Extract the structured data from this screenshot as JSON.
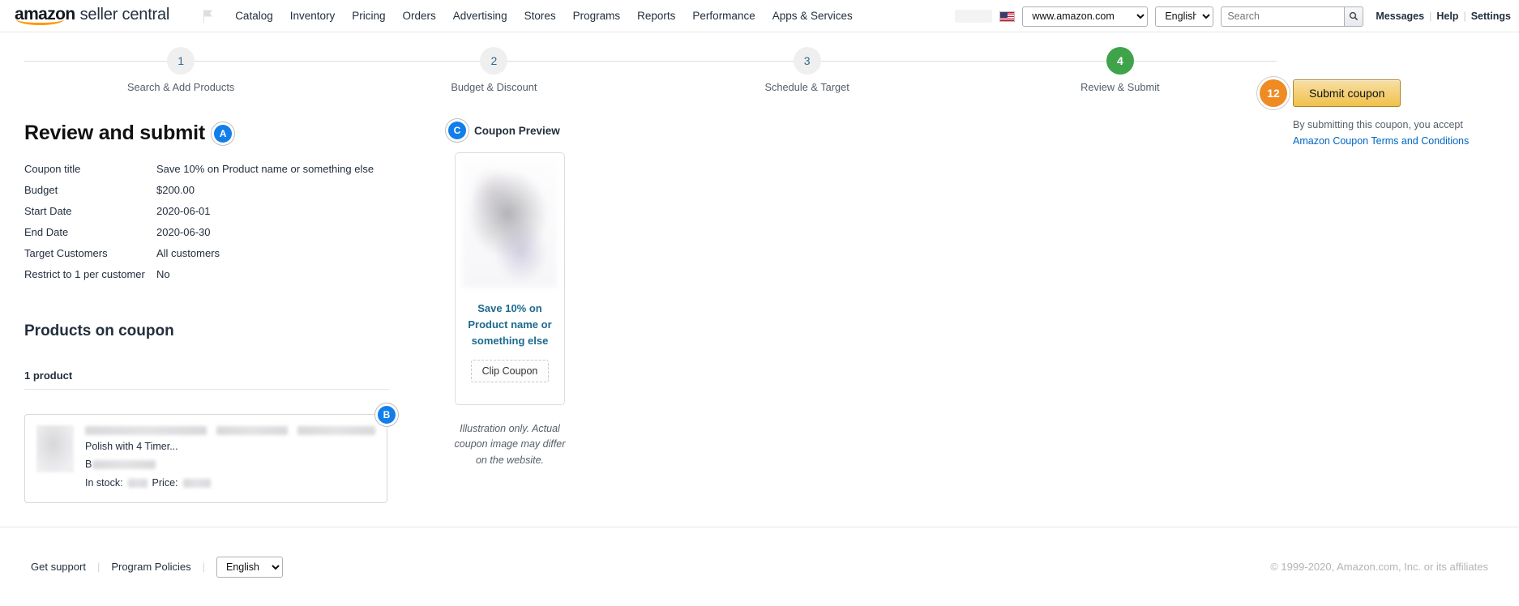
{
  "topnav": {
    "brand_main": "amazon",
    "brand_sub": "seller central",
    "flag_icon": "flag-icon",
    "links": [
      {
        "label": "Catalog"
      },
      {
        "label": "Inventory"
      },
      {
        "label": "Pricing"
      },
      {
        "label": "Orders"
      },
      {
        "label": "Advertising"
      },
      {
        "label": "Stores"
      },
      {
        "label": "Programs"
      },
      {
        "label": "Reports"
      },
      {
        "label": "Performance"
      },
      {
        "label": "Apps & Services"
      }
    ],
    "marketplace": "www.amazon.com",
    "marketplace_options": [
      "www.amazon.com"
    ],
    "language": "English",
    "language_options": [
      "English"
    ],
    "search_placeholder": "Search",
    "search_value": "",
    "search_icon": "search-icon",
    "messages": "Messages",
    "help": "Help",
    "settings": "Settings",
    "divider": "|"
  },
  "stepper": {
    "steps": [
      {
        "number": "1",
        "label": "Search & Add Products",
        "active": false
      },
      {
        "number": "2",
        "label": "Budget & Discount",
        "active": false
      },
      {
        "number": "3",
        "label": "Schedule & Target",
        "active": false
      },
      {
        "number": "4",
        "label": "Review & Submit",
        "active": true
      }
    ]
  },
  "submit": {
    "badge": "12",
    "button_label": "Submit coupon",
    "terms_prefix": "By submitting this coupon, you accept ",
    "terms_link": "Amazon Coupon Terms and Conditions",
    "badge_color": "#ef8b23",
    "button_color": "#f0c14b"
  },
  "review": {
    "marker": "A",
    "title": "Review and submit",
    "rows": [
      {
        "key": "Coupon title",
        "value": "Save 10% on Product name or something else"
      },
      {
        "key": "Budget",
        "value": "$200.00"
      },
      {
        "key": "Start Date",
        "value": "2020-06-01"
      },
      {
        "key": "End Date",
        "value": "2020-06-30"
      },
      {
        "key": "Target Customers",
        "value": "All customers"
      },
      {
        "key": "Restrict to 1 per customer",
        "value": "No"
      }
    ]
  },
  "products": {
    "section_title": "Products on coupon",
    "count_label": "1 product",
    "marker": "B",
    "item": {
      "thumbnail": "product-thumbnail-blurred",
      "title_line": "Polish with 4 Timer...",
      "asin_prefix": "B",
      "stock_label": "In stock:",
      "price_label": "Price:"
    }
  },
  "preview": {
    "marker": "C",
    "heading": "Coupon Preview",
    "coupon_title": "Save 10% on Product name or something else",
    "clip_label": "Clip Coupon",
    "note": "Illustration only. Actual coupon image may differ on the website.",
    "title_color": "#1c6a8e"
  },
  "footer": {
    "get_support": "Get support",
    "program_policies": "Program Policies",
    "language": "English",
    "language_options": [
      "English"
    ],
    "copyright": "© 1999-2020, Amazon.com, Inc. or its affiliates",
    "divider": "|"
  }
}
